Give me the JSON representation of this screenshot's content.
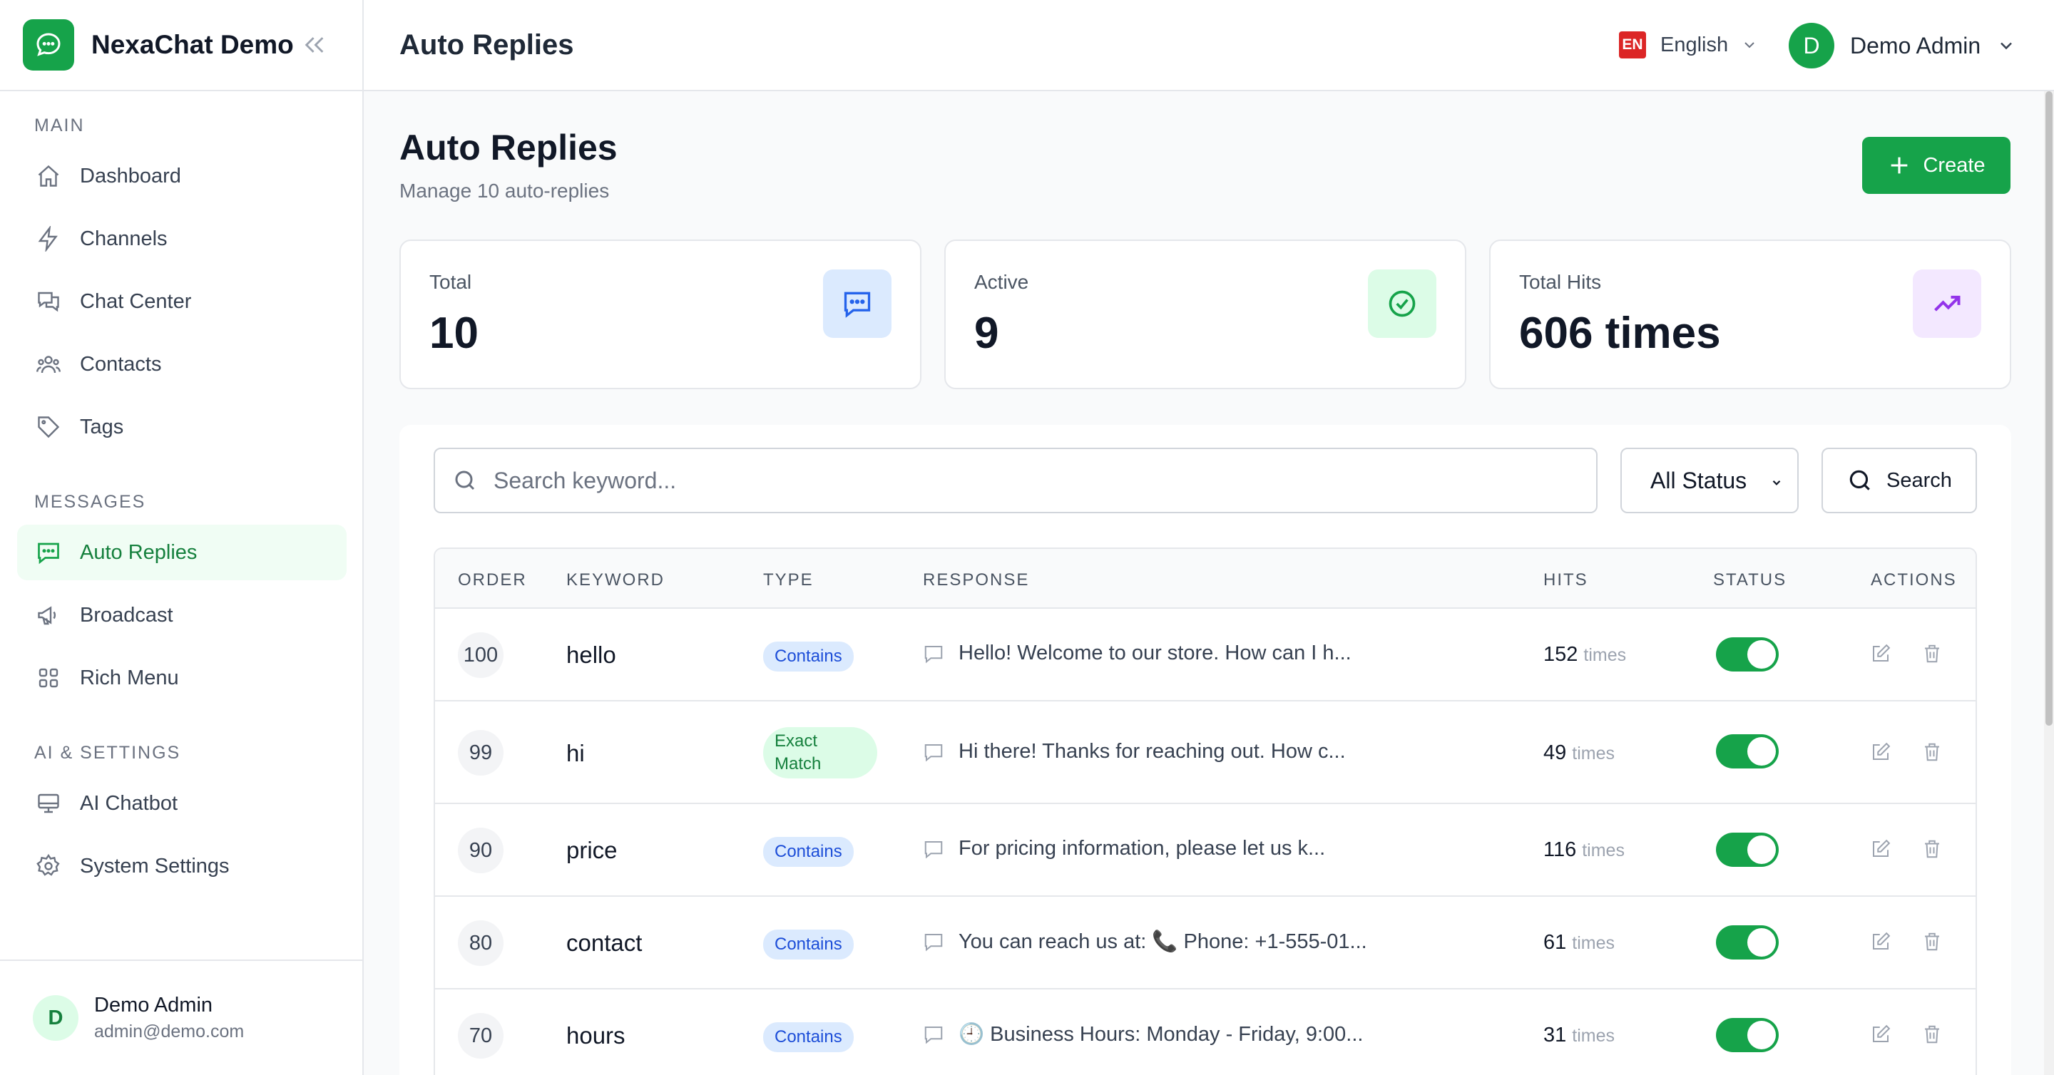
{
  "app": {
    "name": "NexaChat Demo"
  },
  "sidebar": {
    "sections": [
      {
        "title": "MAIN",
        "items": [
          {
            "label": "Dashboard",
            "icon": "home-icon"
          },
          {
            "label": "Channels",
            "icon": "lightning-icon"
          },
          {
            "label": "Chat Center",
            "icon": "chat-bubbles-icon"
          },
          {
            "label": "Contacts",
            "icon": "users-icon"
          },
          {
            "label": "Tags",
            "icon": "tag-icon"
          }
        ]
      },
      {
        "title": "MESSAGES",
        "items": [
          {
            "label": "Auto Replies",
            "icon": "chat-dots-icon",
            "active": true
          },
          {
            "label": "Broadcast",
            "icon": "megaphone-icon"
          },
          {
            "label": "Rich Menu",
            "icon": "grid-icon"
          }
        ]
      },
      {
        "title": "AI & SETTINGS",
        "items": [
          {
            "label": "AI Chatbot",
            "icon": "monitor-icon"
          },
          {
            "label": "System Settings",
            "icon": "gear-icon"
          }
        ]
      }
    ],
    "user": {
      "initial": "D",
      "name": "Demo Admin",
      "email": "admin@demo.com"
    }
  },
  "header": {
    "title": "Auto Replies",
    "language": {
      "code": "EN",
      "label": "English"
    },
    "user": {
      "initial": "D",
      "name": "Demo Admin"
    }
  },
  "page": {
    "title": "Auto Replies",
    "subtitle": "Manage 10 auto-replies",
    "create_label": "Create"
  },
  "stats": [
    {
      "label": "Total",
      "value": "10",
      "icon": "chat-dots-icon",
      "color": "#2563eb",
      "bg": "#dbeafe"
    },
    {
      "label": "Active",
      "value": "9",
      "icon": "check-circle-icon",
      "color": "#16a34a",
      "bg": "#dcfce7"
    },
    {
      "label": "Total Hits",
      "value": "606 times",
      "icon": "trending-up-icon",
      "color": "#9333ea",
      "bg": "#f3e8ff"
    }
  ],
  "filters": {
    "search_placeholder": "Search keyword...",
    "status_selected": "All Status",
    "search_button": "Search"
  },
  "table": {
    "columns": [
      "ORDER",
      "KEYWORD",
      "TYPE",
      "RESPONSE",
      "HITS",
      "STATUS",
      "ACTIONS"
    ],
    "hits_unit": "times",
    "rows": [
      {
        "order": "100",
        "keyword": "hello",
        "type": "Contains",
        "response": "Hello! Welcome to our store. How can I h...",
        "hits": "152",
        "status": true
      },
      {
        "order": "99",
        "keyword": "hi",
        "type": "Exact Match",
        "response": "Hi there! Thanks for reaching out. How c...",
        "hits": "49",
        "status": true
      },
      {
        "order": "90",
        "keyword": "price",
        "type": "Contains",
        "response": "For pricing information, please let us k...",
        "hits": "116",
        "status": true
      },
      {
        "order": "80",
        "keyword": "contact",
        "type": "Contains",
        "response": "You can reach us at: 📞 Phone: +1-555-01...",
        "hits": "61",
        "status": true
      },
      {
        "order": "70",
        "keyword": "hours",
        "type": "Contains",
        "response": "🕘 Business Hours: Monday - Friday, 9:00...",
        "hits": "31",
        "status": true
      }
    ]
  },
  "colors": {
    "brand": "#16a34a",
    "active_bg": "#f0fdf4",
    "badge_blue": "#dbeafe",
    "badge_green": "#dcfce7"
  }
}
